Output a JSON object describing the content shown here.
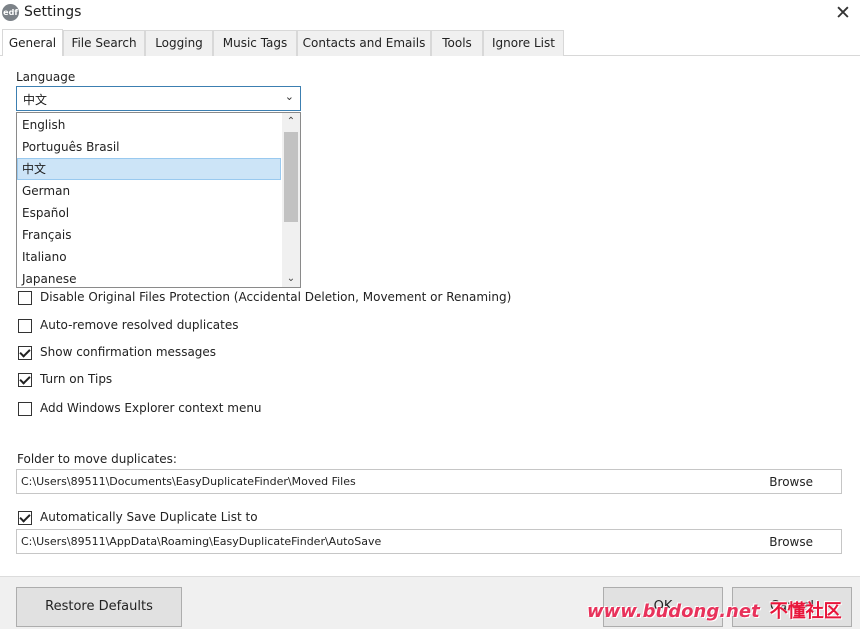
{
  "window": {
    "title": "Settings",
    "icon_text": "edf",
    "close_glyph": "✕"
  },
  "tabs": [
    {
      "label": "General",
      "active": true
    },
    {
      "label": "File Search"
    },
    {
      "label": "Logging"
    },
    {
      "label": "Music Tags"
    },
    {
      "label": "Contacts and Emails"
    },
    {
      "label": "Tools"
    },
    {
      "label": "Ignore List"
    }
  ],
  "language": {
    "label": "Language",
    "selected": "中文",
    "options": [
      "English",
      "Português Brasil",
      "中文",
      "German",
      "Español",
      "Français",
      "Italiano",
      "Japanese"
    ],
    "selected_index": 2
  },
  "checkboxes": [
    {
      "label": "Disable Original Files Protection (Accidental Deletion, Movement or Renaming)",
      "checked": false
    },
    {
      "label": "Auto-remove resolved duplicates",
      "checked": false
    },
    {
      "label": "Show confirmation messages",
      "checked": true
    },
    {
      "label": "Turn on Tips",
      "checked": true
    },
    {
      "label": "Add Windows Explorer context menu",
      "checked": false
    }
  ],
  "folder": {
    "label": "Folder to move duplicates:",
    "path": "C:\\Users\\89511\\Documents\\EasyDuplicateFinder\\Moved Files",
    "browse": "Browse"
  },
  "autosave": {
    "label": "Automatically Save Duplicate List to",
    "checked": true,
    "path": "C:\\Users\\89511\\AppData\\Roaming\\EasyDuplicateFinder\\AutoSave",
    "browse": "Browse"
  },
  "footer": {
    "restore_label": "Restore Defaults",
    "ok_label": "OK",
    "cancel_label": "Cancel"
  },
  "watermark": {
    "url": "www.budong.net",
    "cn": "不懂社区"
  },
  "colors": {
    "accent_border": "#3c7fb1",
    "selection": "#cce4f7",
    "watermark": "#e8325b"
  }
}
